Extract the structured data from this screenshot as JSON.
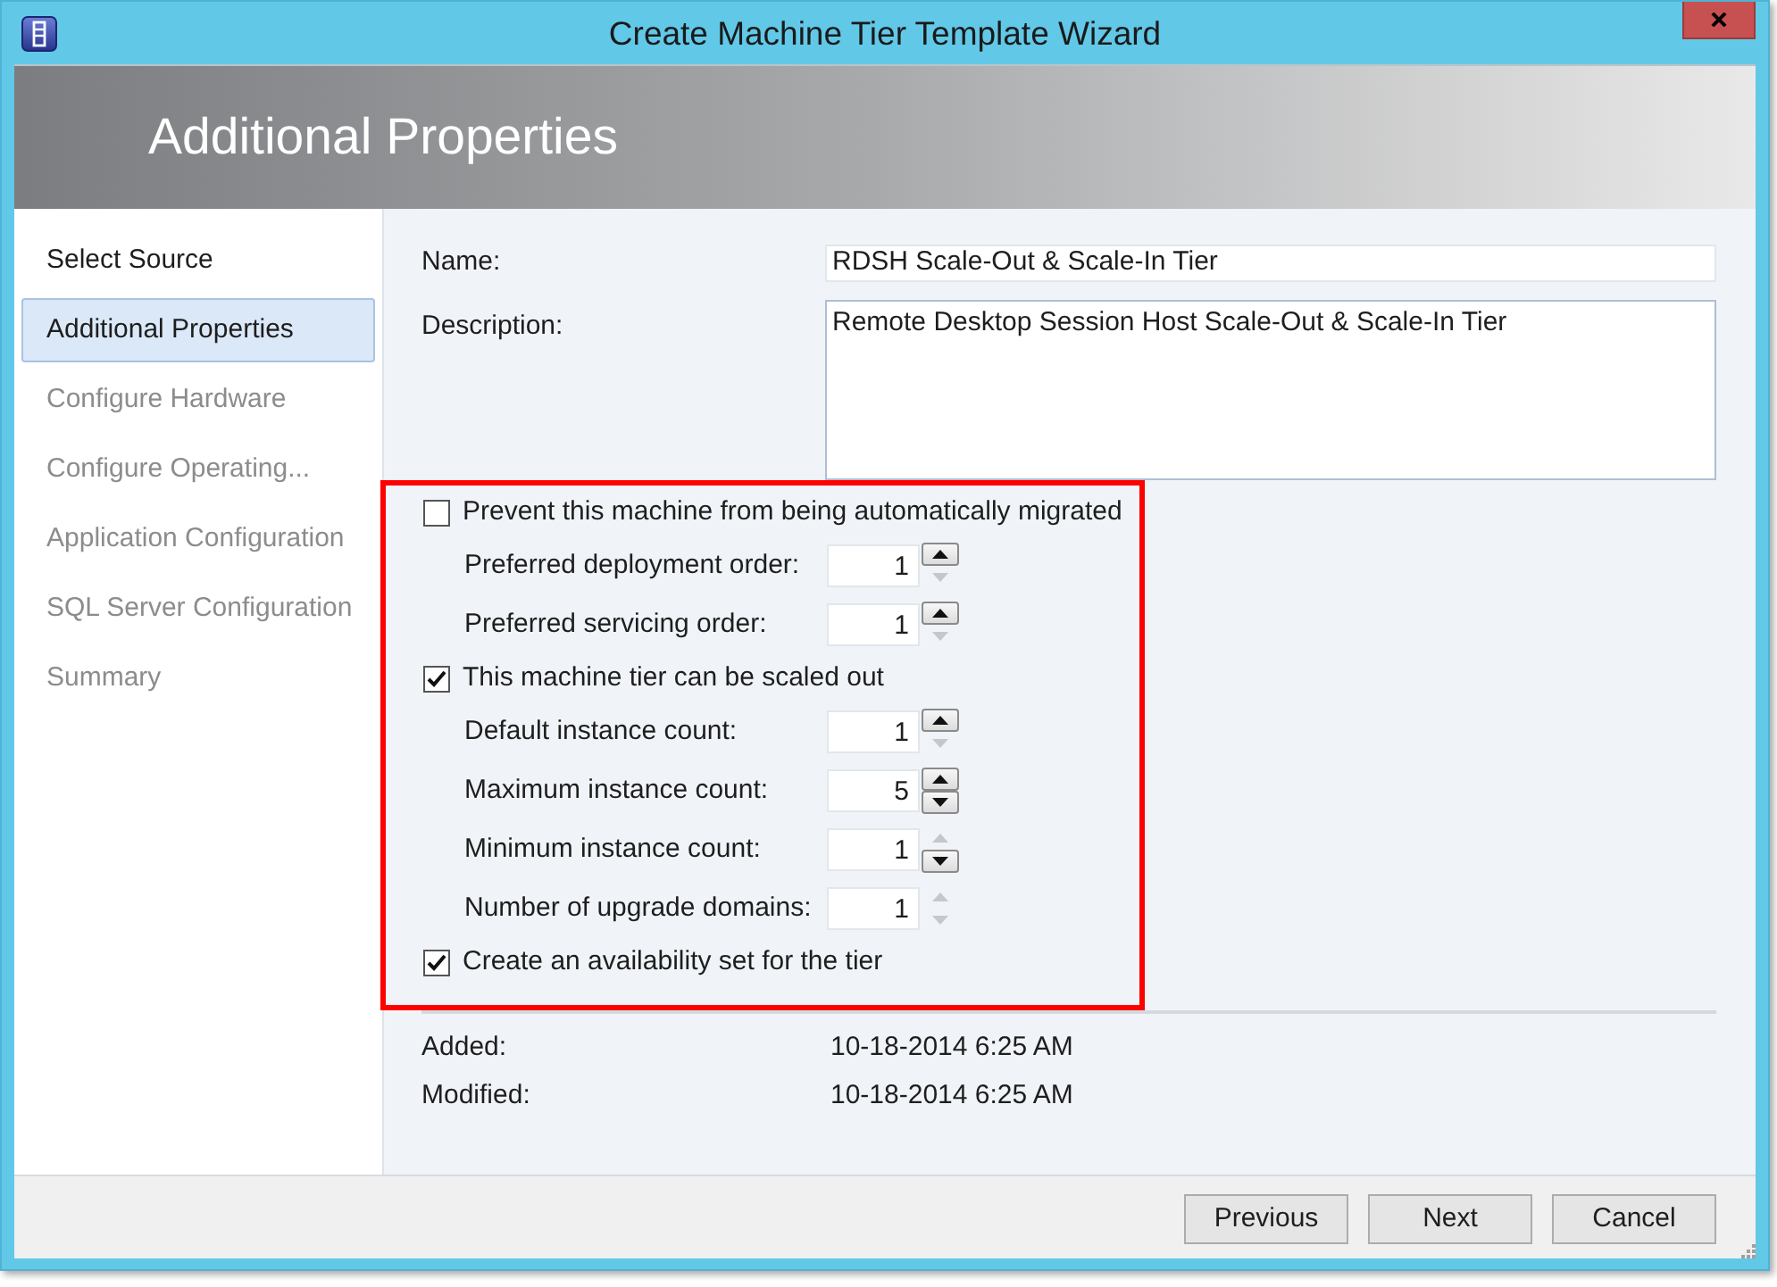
{
  "window": {
    "title": "Create Machine Tier Template Wizard"
  },
  "header": {
    "title": "Additional Properties"
  },
  "steps": [
    {
      "label": "Select Source",
      "selected": false,
      "disabled": false
    },
    {
      "label": "Additional Properties",
      "selected": true,
      "disabled": false
    },
    {
      "label": "Configure Hardware",
      "selected": false,
      "disabled": true
    },
    {
      "label": "Configure Operating...",
      "selected": false,
      "disabled": true
    },
    {
      "label": "Application Configuration",
      "selected": false,
      "disabled": true
    },
    {
      "label": "SQL Server Configuration",
      "selected": false,
      "disabled": true
    },
    {
      "label": "Summary",
      "selected": false,
      "disabled": true
    }
  ],
  "fields": [
    {
      "kind": "text",
      "label": "Name:",
      "value": "RDSH Scale-Out & Scale-In Tier"
    },
    {
      "kind": "multiline",
      "label": "Description:",
      "value": "Remote Desktop Session Host Scale-Out & Scale-In Tier"
    }
  ],
  "options": {
    "highlighted": true,
    "items": [
      {
        "kind": "checkbox",
        "label": "Prevent this machine from being automatically migrated",
        "checked": false
      },
      {
        "kind": "spinner",
        "label": "Preferred deployment order:",
        "value": "1",
        "up_enabled": true,
        "down_enabled": false
      },
      {
        "kind": "spinner",
        "label": "Preferred servicing order:",
        "value": "1",
        "up_enabled": true,
        "down_enabled": false
      },
      {
        "kind": "checkbox",
        "label": "This machine tier can be scaled out",
        "checked": true
      },
      {
        "kind": "spinner",
        "label": "Default instance count:",
        "value": "1",
        "up_enabled": true,
        "down_enabled": false
      },
      {
        "kind": "spinner",
        "label": "Maximum instance count:",
        "value": "5",
        "up_enabled": true,
        "down_enabled": true
      },
      {
        "kind": "spinner",
        "label": "Minimum instance count:",
        "value": "1",
        "up_enabled": false,
        "down_enabled": true
      },
      {
        "kind": "spinner",
        "label": "Number of upgrade domains:",
        "value": "1",
        "up_enabled": false,
        "down_enabled": false
      },
      {
        "kind": "checkbox",
        "label": "Create an availability set for the tier",
        "checked": true
      }
    ]
  },
  "details": [
    {
      "label": "Added:",
      "value": "10-18-2014 6:25 AM"
    },
    {
      "label": "Modified:",
      "value": "10-18-2014 6:25 AM"
    }
  ],
  "buttons": [
    {
      "label": "Previous"
    },
    {
      "label": "Next"
    },
    {
      "label": "Cancel"
    }
  ]
}
